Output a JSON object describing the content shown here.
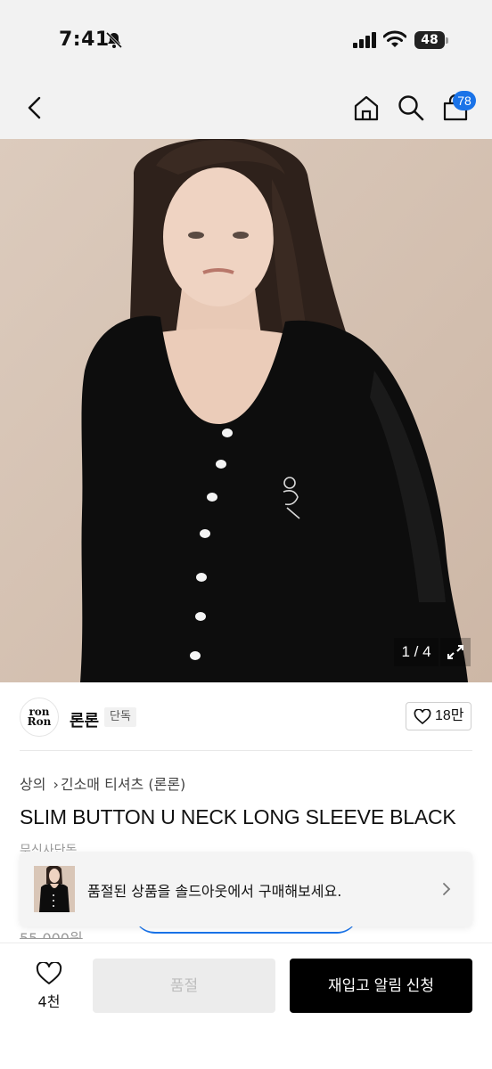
{
  "status": {
    "time": "7:41",
    "battery": "48",
    "battery_level": 0.48
  },
  "nav": {
    "cart_count": "78"
  },
  "gallery": {
    "counter": "1 / 4"
  },
  "brand": {
    "logo_line1": "ron",
    "logo_line2": "Ron",
    "name": "론론",
    "tag": "단독",
    "likes": "18만"
  },
  "breadcrumb": [
    "상의",
    "긴소매 티셔츠 (론론)"
  ],
  "product": {
    "title": "SLIM BUTTON U NECK LONG SLEEVE BLACK",
    "partial_label": "무신사단독",
    "original_price": "55,000원"
  },
  "toast": {
    "message": "품절된 상품을 솔드아웃에서 구매해보세요."
  },
  "bottom": {
    "wish_count": "4천",
    "soldout_label": "품절",
    "restock_label": "재입고 알림 신청"
  },
  "colors": {
    "accent": "#1a73e8",
    "primary_button": "#000000",
    "disabled_button": "#ececec"
  },
  "icons": [
    "bell-off-icon",
    "signal-icon",
    "wifi-icon",
    "battery-icon",
    "back-arrow-icon",
    "home-icon",
    "search-icon",
    "cart-icon",
    "expand-icon",
    "heart-icon",
    "chevron-right-icon"
  ]
}
